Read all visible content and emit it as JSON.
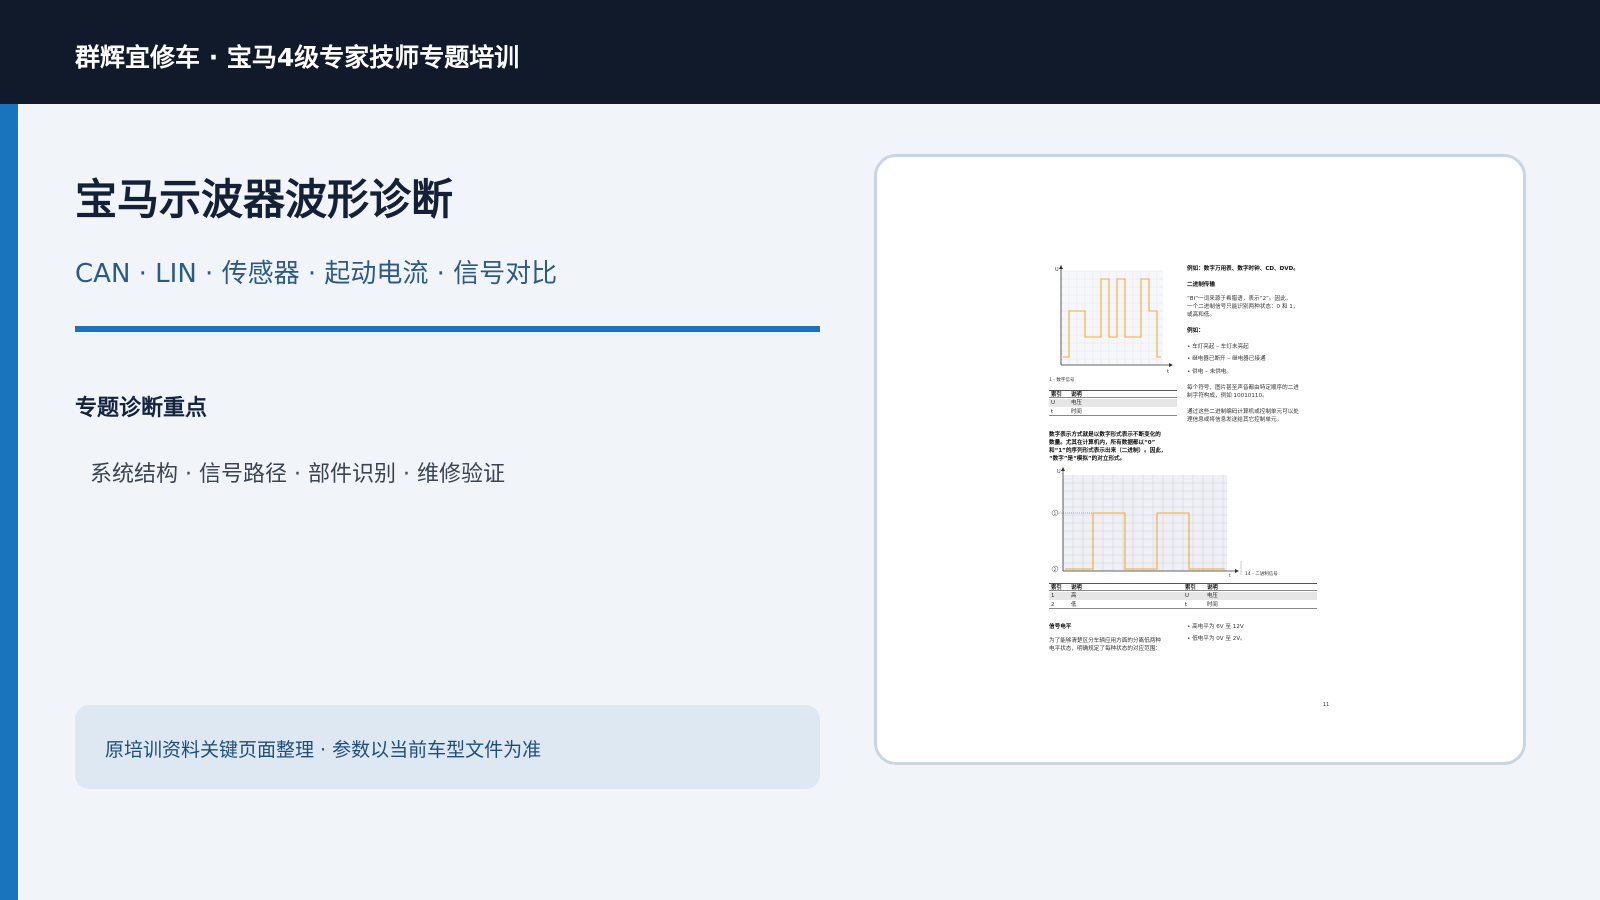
{
  "header": {
    "title": "群辉宜修车 · 宝马4级专家技师专题培训"
  },
  "main": {
    "title": "宝马示波器波形诊断",
    "subtitle": "CAN · LIN · 传感器 · 起动电流 · 信号对比",
    "section_heading": "专题诊断重点",
    "section_body": "系统结构 · 信号路径 · 部件识别 · 维修验证",
    "note": "原培训资料关键页面整理 · 参数以当前车型文件为准"
  },
  "colors": {
    "header_bg": "#111a2b",
    "accent": "#1a73bd",
    "page_bg": "#f1f5fa",
    "note_bg": "#dde8f3",
    "waveform": "#f2a93b"
  },
  "document_page": {
    "right_col": [
      "例如：数字万用表、数字时钟、CD、DVD。",
      "二进制传输",
      "“Bi”一词来源于希腊语，表示“2”。因此，",
      "一个二进制信号只能识别两种状态：0 和 1，",
      "或高和低。",
      "例如：",
      "车灯亮起 – 车灯未亮起",
      "继电器已断开 – 继电器已接通",
      "供电 – 未供电。",
      "每个符号、图片甚至声音都由特定顺序的二进",
      "制字符构成，例如 10010110。",
      "通过这些二进制编码计算机或控制单元可以处",
      "理信息或将信息发送给其它控制单元。"
    ],
    "fig1_caption": "1 - 数字信号",
    "table1_header": [
      "索引",
      "说明"
    ],
    "table1_rows": [
      [
        "U",
        "电压"
      ],
      [
        "t",
        "时间"
      ]
    ],
    "para": [
      "数字表示方式就是以数字形式表示不断变化的",
      "数量。尤其在计算机内，所有数据都以“0”",
      "和“1”的序列形式表示出来（二进制）。因此，",
      "“数字”是“模拟”的对立形式。"
    ],
    "fig2_caption": "14 - 二进制信号",
    "table2_header": [
      "索引",
      "说明",
      "索引",
      "说明"
    ],
    "table2_rows": [
      [
        "1",
        "高",
        "U",
        "电压"
      ],
      [
        "2",
        "低",
        "t",
        "时间"
      ]
    ],
    "signal_heading": "信号电平",
    "signal_text": [
      "为了能够清楚区分车辆应用方面的分离低两种",
      "电平状态，明确规定了每种状态的对应范围："
    ],
    "signal_bullets": [
      "高电平为 6V 至 12V",
      "低电平为 0V 至 2V。"
    ],
    "page_number": "11"
  }
}
